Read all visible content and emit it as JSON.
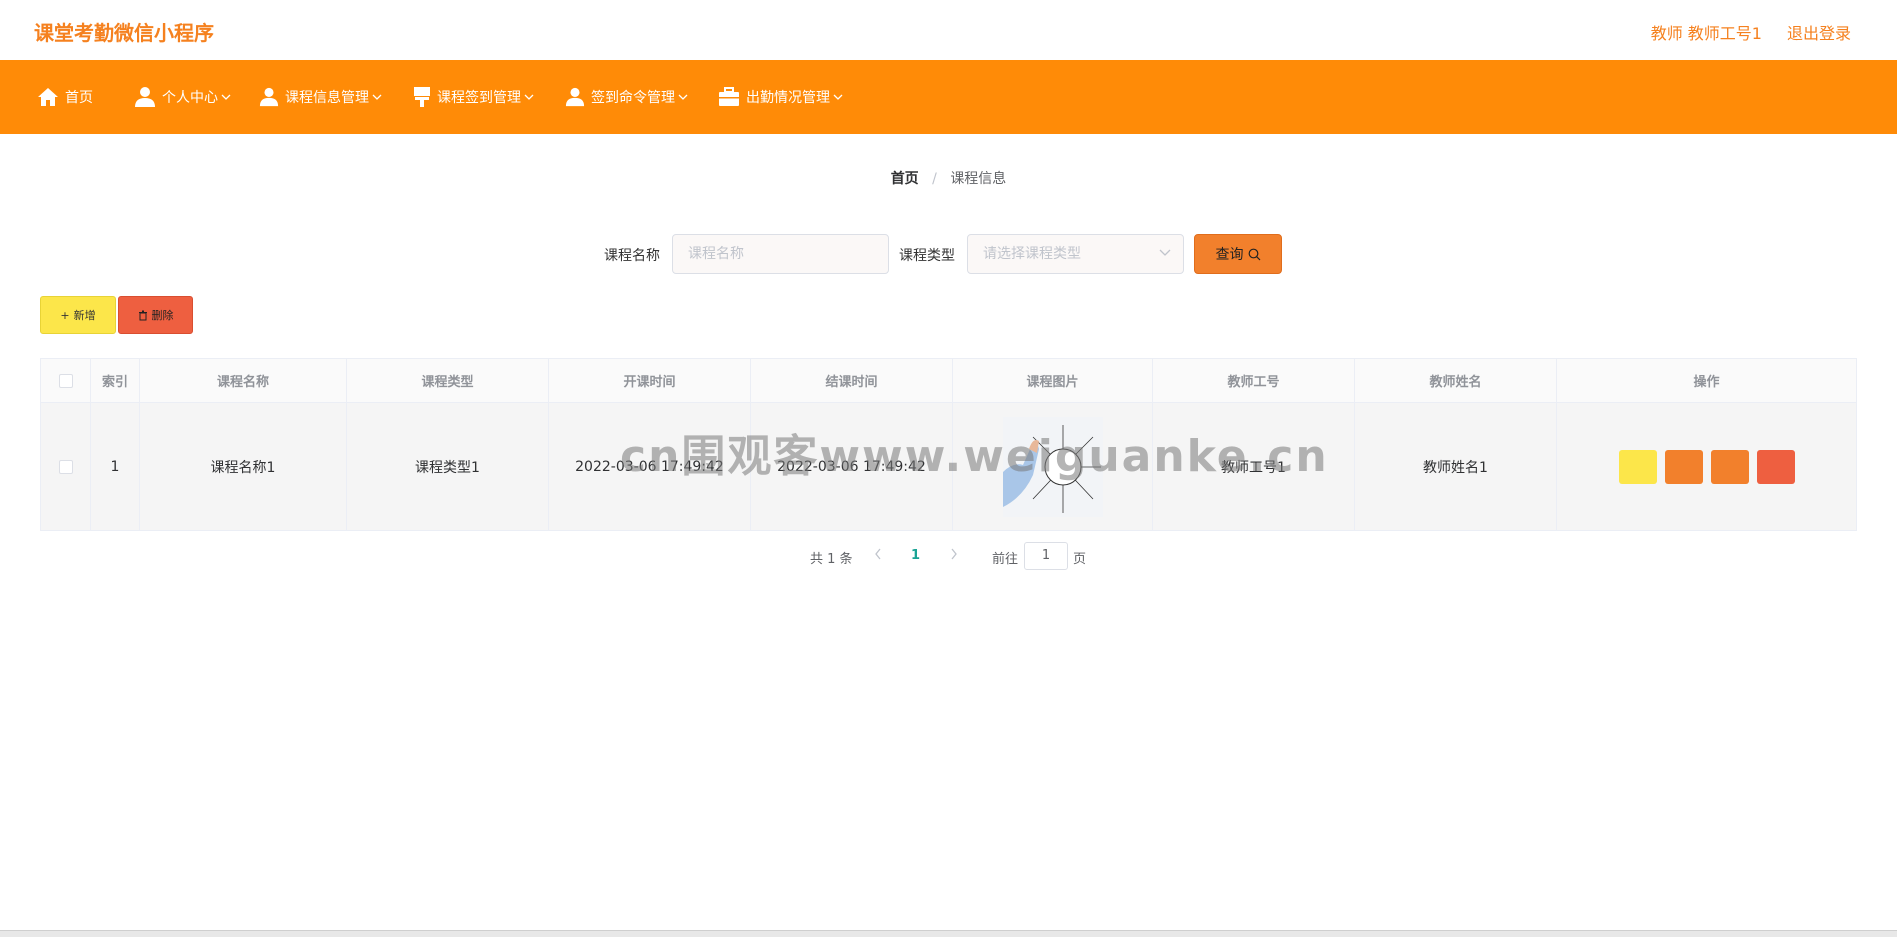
{
  "header": {
    "app_title": "课堂考勤微信小程序",
    "user_info": "教师 教师工号1",
    "logout_label": "退出登录"
  },
  "nav": {
    "items": [
      {
        "label": "首页",
        "icon": "home-icon"
      },
      {
        "label": "个人中心",
        "icon": "user-icon"
      },
      {
        "label": "课程信息管理",
        "icon": "user-icon"
      },
      {
        "label": "课程签到管理",
        "icon": "brush-icon"
      },
      {
        "label": "签到命令管理",
        "icon": "user-icon"
      },
      {
        "label": "出勤情况管理",
        "icon": "briefcase-icon"
      }
    ]
  },
  "breadcrumb": {
    "home": "首页",
    "separator": "/",
    "current": "课程信息"
  },
  "search": {
    "name_label": "课程名称",
    "name_placeholder": "课程名称",
    "type_label": "课程类型",
    "type_placeholder": "请选择课程类型",
    "query_label": "查询"
  },
  "actions": {
    "add_label": "新增",
    "delete_label": "删除"
  },
  "table": {
    "columns": [
      "索引",
      "课程名称",
      "课程类型",
      "开课时间",
      "结课时间",
      "课程图片",
      "教师工号",
      "教师姓名",
      "操作"
    ],
    "rows": [
      {
        "index": "1",
        "course_name": "课程名称1",
        "course_type": "课程类型1",
        "start_time": "2022-03-06 17:49:42",
        "end_time": "2022-03-06 17:49:42",
        "teacher_id": "教师工号1",
        "teacher_name": "教师姓名1"
      }
    ]
  },
  "pagination": {
    "total": "共 1 条",
    "current_page": "1",
    "goto_label": "前往",
    "goto_value": "1",
    "page_suffix": "页"
  },
  "watermark": "cn围观客www.weiguanke.cn",
  "colors": {
    "accent": "#f5811f",
    "nav_bg": "#ff8b07",
    "yellow_btn": "#fce64a",
    "orange_btn": "#f2802c",
    "red_btn": "#ee5f40",
    "page_active": "#19a394"
  }
}
